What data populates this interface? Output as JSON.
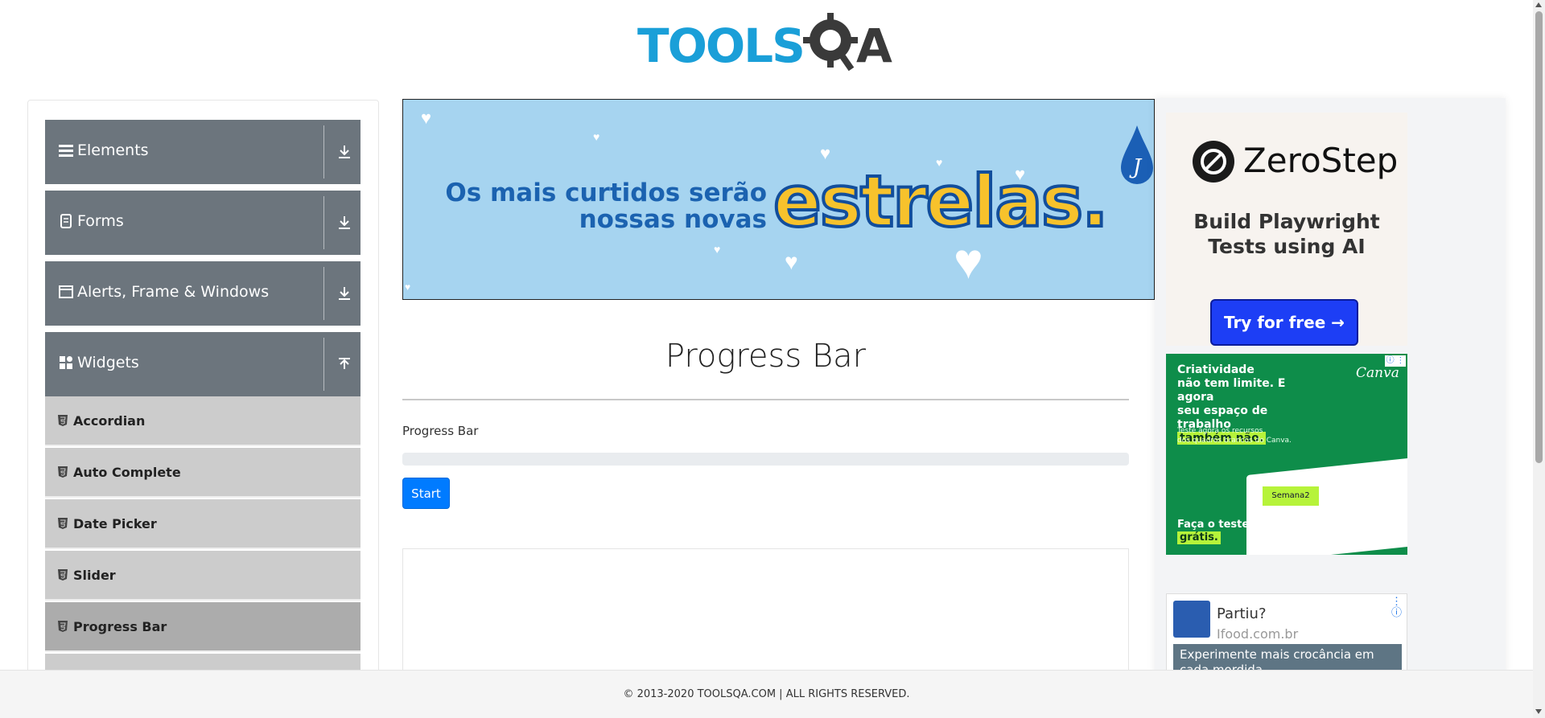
{
  "header": {
    "logo_text": "TOOLSQA"
  },
  "sidebar": {
    "groups": [
      {
        "label": "Elements",
        "icon": "menu-icon",
        "arrow": "download-icon"
      },
      {
        "label": "Forms",
        "icon": "document-icon",
        "arrow": "download-icon"
      },
      {
        "label": "Alerts, Frame & Windows",
        "icon": "window-icon",
        "arrow": "download-icon"
      },
      {
        "label": "Widgets",
        "icon": "grid-icon",
        "arrow": "upload-icon"
      }
    ],
    "items": [
      {
        "label": "Accordian",
        "icon": "html5-icon"
      },
      {
        "label": "Auto Complete",
        "icon": "html5-icon"
      },
      {
        "label": "Date Picker",
        "icon": "html5-icon"
      },
      {
        "label": "Slider",
        "icon": "html5-icon"
      },
      {
        "label": "Progress Bar",
        "icon": "html5-icon",
        "active": true
      }
    ]
  },
  "banner": {
    "small_line1": "Os mais curtidos serão",
    "small_line2": "nossas novas",
    "big": "estrelas.",
    "drop_letter": "J"
  },
  "main": {
    "title": "Progress Bar",
    "progress_label": "Progress Bar",
    "progress_value": 0,
    "start_label": "Start"
  },
  "ads": {
    "zerostep": {
      "name": "ZeroStep",
      "tagline_line1": "Build Playwright",
      "tagline_line2": "Tests using AI",
      "button": "Try for free →"
    },
    "canva": {
      "line1": "Criatividade",
      "line2": "não tem limite. E agora",
      "line3": "seu espaço de trabalho",
      "highlight": "também não.",
      "brand": "Canva",
      "sub_line1": "Teste agora os recursos",
      "sub_line2": "dos quadros brancos do Canva.",
      "note": "Semana2",
      "cta_line1": "Faça o teste",
      "cta_line2": "grátis."
    },
    "ifood": {
      "title": "Partiu?",
      "domain": "Ifood.com.br",
      "body": "Experimente mais crocância em cada mordida"
    }
  },
  "footer": {
    "text": "© 2013-2020 TOOLSQA.COM | ALL RIGHTS RESERVED."
  },
  "colors": {
    "accent": "#007bff",
    "sidebar_group": "#6c757d",
    "sidebar_item": "#cccccc",
    "sidebar_active": "#acacac",
    "logo_blue": "#1a9fd8",
    "logo_dark": "#3a3a3a"
  }
}
